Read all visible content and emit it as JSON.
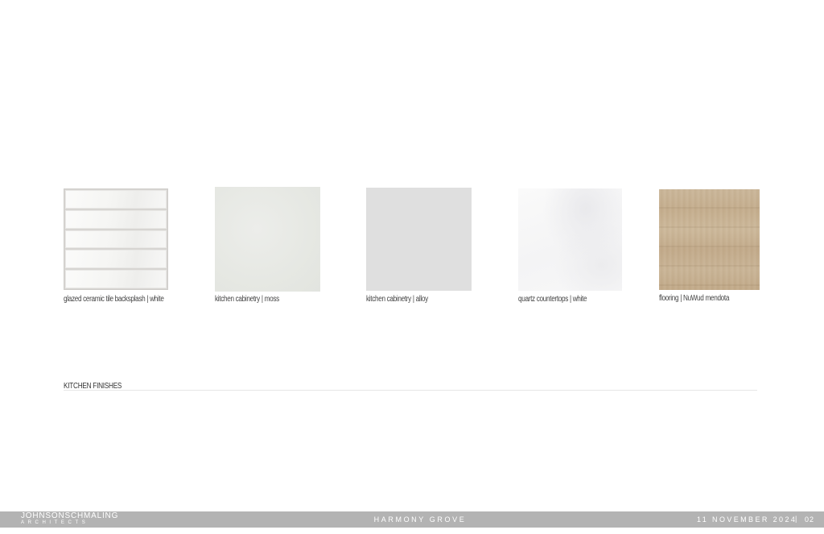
{
  "finishes": [
    {
      "caption": "glazed ceramic tile backsplash | white"
    },
    {
      "caption": "kitchen cabinetry | moss"
    },
    {
      "caption": "kitchen cabinetry | alloy"
    },
    {
      "caption": "quartz countertops | white"
    },
    {
      "caption": "flooring | NuWud mendota"
    }
  ],
  "section": {
    "title": "KITCHEN FINISHES"
  },
  "footer": {
    "logo_main": "JOHNSONSCHMALING",
    "logo_sub": "ARCHITECTS",
    "project": "HARMONY GROVE",
    "date": "11 NOVEMBER 2024",
    "separator": "|",
    "page": "02"
  },
  "colors": {
    "footer_bar": "#b3b3b3",
    "alloy": "#dfdfdf",
    "wood": "#c8b394"
  }
}
